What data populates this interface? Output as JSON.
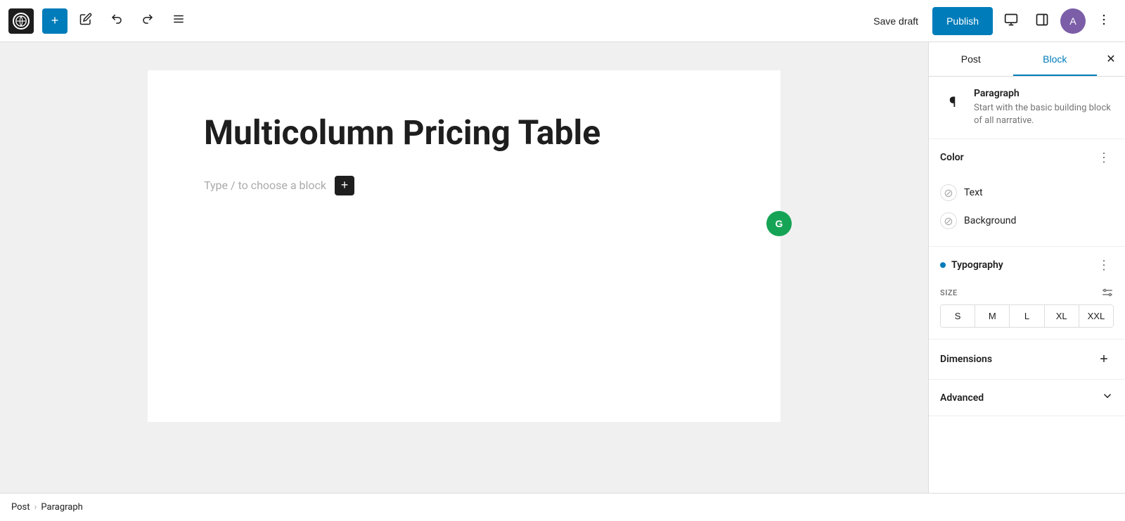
{
  "toolbar": {
    "add_label": "+",
    "save_draft_label": "Save draft",
    "publish_label": "Publish",
    "wp_logo_text": "W"
  },
  "editor": {
    "post_title": "Multicolumn Pricing Table",
    "block_placeholder": "Type / to choose a block",
    "grammarly_letter": "G"
  },
  "breadcrumb": {
    "post_label": "Post",
    "separator": "›",
    "current_label": "Paragraph"
  },
  "sidebar": {
    "tab_post_label": "Post",
    "tab_block_label": "Block",
    "active_tab": "Block",
    "block_info": {
      "title": "Paragraph",
      "description": "Start with the basic building block of all narrative."
    },
    "color_section": {
      "title": "Color",
      "text_label": "Text",
      "background_label": "Background"
    },
    "typography_section": {
      "title": "Typography",
      "size_label": "SIZE",
      "sizes": [
        "S",
        "M",
        "L",
        "XL",
        "XXL"
      ]
    },
    "dimensions_section": {
      "title": "Dimensions"
    },
    "advanced_section": {
      "title": "Advanced"
    }
  }
}
